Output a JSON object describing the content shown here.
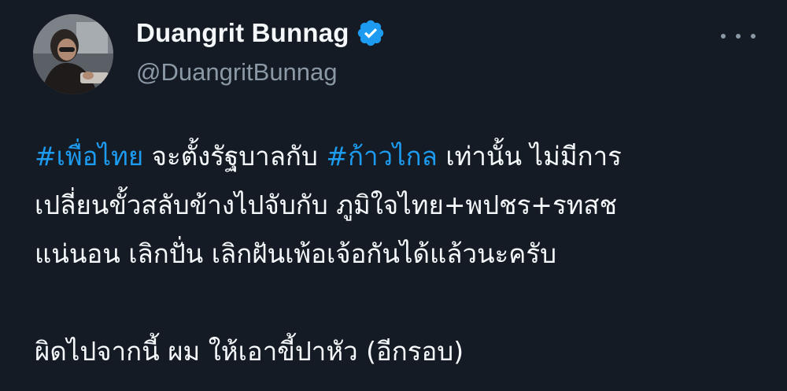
{
  "user": {
    "display_name": "Duangrit Bunnag",
    "handle": "@DuangritBunnag",
    "verified": true
  },
  "tweet": {
    "line1": {
      "hashtag1": "#เพื่อไทย",
      "text1": " จะตั้งรัฐบาลกับ ",
      "hashtag2": "#ก้าวไกล",
      "text2": " เท่านั้น ไม่มีการ"
    },
    "line2": "เปลี่ยนขั้วสลับข้างไปจับกับ ภูมิใจไทย+พปชร+รทสช",
    "line3": "แน่นอน เลิกปั่น เลิกฝันเพ้อเจ้อกันได้แล้วนะครับ",
    "line5": "ผิดไปจากนี้ ผม ให้เอาขี้ปาหัว (อีกรอบ)"
  },
  "colors": {
    "background": "#141b24",
    "text": "#f5f8fa",
    "secondary_text": "#8b98a5",
    "accent": "#1d9bf0"
  },
  "icons": {
    "verified": "verified-badge-icon",
    "more": "more-horizontal-icon"
  }
}
